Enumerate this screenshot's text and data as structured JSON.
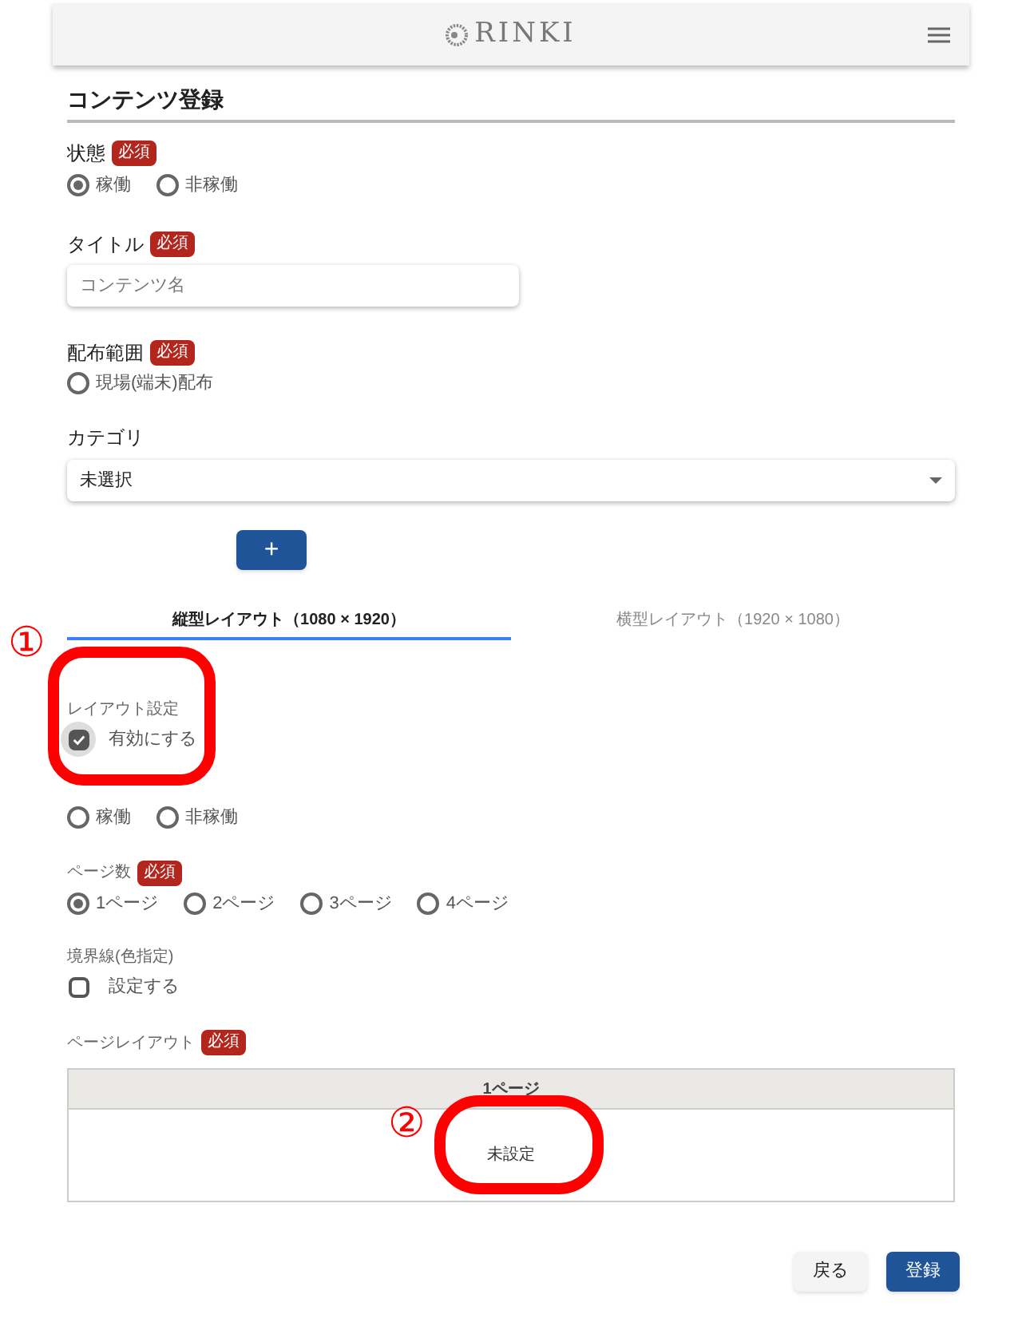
{
  "header": {
    "logo": "RINKI"
  },
  "page_title": "コンテンツ登録",
  "status": {
    "label": "状態",
    "badge": "必須",
    "options": [
      {
        "label": "稼働",
        "selected": true
      },
      {
        "label": "非稼働",
        "selected": false
      }
    ]
  },
  "title_field": {
    "label": "タイトル",
    "badge": "必須",
    "placeholder": "コンテンツ名"
  },
  "distribution": {
    "label": "配布範囲",
    "badge": "必須",
    "options": [
      {
        "label": "現場(端末)配布",
        "selected": false
      }
    ]
  },
  "category": {
    "label": "カテゴリ",
    "value": "未選択"
  },
  "add_button": "+",
  "tabs": [
    {
      "label": "縦型レイアウト（1080 × 1920）",
      "selected": true
    },
    {
      "label": "横型レイアウト（1920 × 1080）",
      "selected": false
    }
  ],
  "layout_setting": {
    "label": "レイアウト設定",
    "checkbox": {
      "label": "有効にする",
      "checked": true
    }
  },
  "layout_status": {
    "options": [
      {
        "label": "稼働",
        "selected": false
      },
      {
        "label": "非稼働",
        "selected": false
      }
    ]
  },
  "page_count": {
    "label": "ページ数",
    "badge": "必須",
    "options": [
      {
        "label": "1ページ",
        "selected": true
      },
      {
        "label": "2ページ",
        "selected": false
      },
      {
        "label": "3ページ",
        "selected": false
      },
      {
        "label": "4ページ",
        "selected": false
      }
    ]
  },
  "border": {
    "label": "境界線(色指定)",
    "checkbox": {
      "label": "設定する",
      "checked": false
    }
  },
  "page_layout": {
    "label": "ページレイアウト",
    "badge": "必須",
    "columns": [
      "1ページ"
    ],
    "cells": [
      "未設定"
    ]
  },
  "buttons": [
    {
      "label": "戻る",
      "kind": "secondary"
    },
    {
      "label": "登録",
      "kind": "primary"
    }
  ],
  "annotations": [
    {
      "label": "①"
    },
    {
      "label": "②"
    }
  ]
}
